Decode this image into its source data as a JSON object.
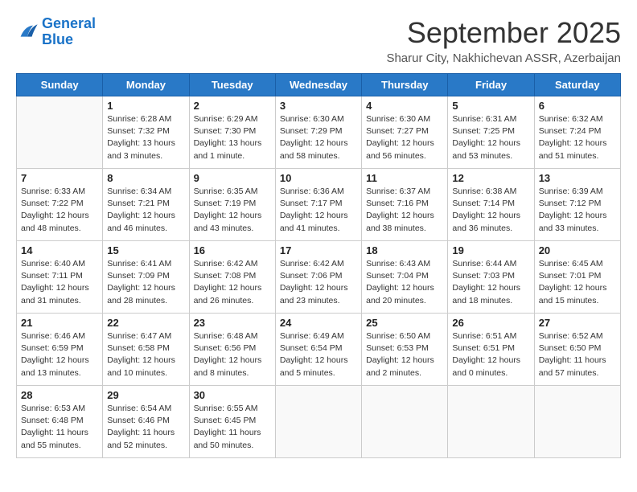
{
  "header": {
    "logo_line1": "General",
    "logo_line2": "Blue",
    "month": "September 2025",
    "location": "Sharur City, Nakhichevan ASSR, Azerbaijan"
  },
  "weekdays": [
    "Sunday",
    "Monday",
    "Tuesday",
    "Wednesday",
    "Thursday",
    "Friday",
    "Saturday"
  ],
  "weeks": [
    [
      {
        "day": "",
        "info": ""
      },
      {
        "day": "1",
        "info": "Sunrise: 6:28 AM\nSunset: 7:32 PM\nDaylight: 13 hours\nand 3 minutes."
      },
      {
        "day": "2",
        "info": "Sunrise: 6:29 AM\nSunset: 7:30 PM\nDaylight: 13 hours\nand 1 minute."
      },
      {
        "day": "3",
        "info": "Sunrise: 6:30 AM\nSunset: 7:29 PM\nDaylight: 12 hours\nand 58 minutes."
      },
      {
        "day": "4",
        "info": "Sunrise: 6:30 AM\nSunset: 7:27 PM\nDaylight: 12 hours\nand 56 minutes."
      },
      {
        "day": "5",
        "info": "Sunrise: 6:31 AM\nSunset: 7:25 PM\nDaylight: 12 hours\nand 53 minutes."
      },
      {
        "day": "6",
        "info": "Sunrise: 6:32 AM\nSunset: 7:24 PM\nDaylight: 12 hours\nand 51 minutes."
      }
    ],
    [
      {
        "day": "7",
        "info": "Sunrise: 6:33 AM\nSunset: 7:22 PM\nDaylight: 12 hours\nand 48 minutes."
      },
      {
        "day": "8",
        "info": "Sunrise: 6:34 AM\nSunset: 7:21 PM\nDaylight: 12 hours\nand 46 minutes."
      },
      {
        "day": "9",
        "info": "Sunrise: 6:35 AM\nSunset: 7:19 PM\nDaylight: 12 hours\nand 43 minutes."
      },
      {
        "day": "10",
        "info": "Sunrise: 6:36 AM\nSunset: 7:17 PM\nDaylight: 12 hours\nand 41 minutes."
      },
      {
        "day": "11",
        "info": "Sunrise: 6:37 AM\nSunset: 7:16 PM\nDaylight: 12 hours\nand 38 minutes."
      },
      {
        "day": "12",
        "info": "Sunrise: 6:38 AM\nSunset: 7:14 PM\nDaylight: 12 hours\nand 36 minutes."
      },
      {
        "day": "13",
        "info": "Sunrise: 6:39 AM\nSunset: 7:12 PM\nDaylight: 12 hours\nand 33 minutes."
      }
    ],
    [
      {
        "day": "14",
        "info": "Sunrise: 6:40 AM\nSunset: 7:11 PM\nDaylight: 12 hours\nand 31 minutes."
      },
      {
        "day": "15",
        "info": "Sunrise: 6:41 AM\nSunset: 7:09 PM\nDaylight: 12 hours\nand 28 minutes."
      },
      {
        "day": "16",
        "info": "Sunrise: 6:42 AM\nSunset: 7:08 PM\nDaylight: 12 hours\nand 26 minutes."
      },
      {
        "day": "17",
        "info": "Sunrise: 6:42 AM\nSunset: 7:06 PM\nDaylight: 12 hours\nand 23 minutes."
      },
      {
        "day": "18",
        "info": "Sunrise: 6:43 AM\nSunset: 7:04 PM\nDaylight: 12 hours\nand 20 minutes."
      },
      {
        "day": "19",
        "info": "Sunrise: 6:44 AM\nSunset: 7:03 PM\nDaylight: 12 hours\nand 18 minutes."
      },
      {
        "day": "20",
        "info": "Sunrise: 6:45 AM\nSunset: 7:01 PM\nDaylight: 12 hours\nand 15 minutes."
      }
    ],
    [
      {
        "day": "21",
        "info": "Sunrise: 6:46 AM\nSunset: 6:59 PM\nDaylight: 12 hours\nand 13 minutes."
      },
      {
        "day": "22",
        "info": "Sunrise: 6:47 AM\nSunset: 6:58 PM\nDaylight: 12 hours\nand 10 minutes."
      },
      {
        "day": "23",
        "info": "Sunrise: 6:48 AM\nSunset: 6:56 PM\nDaylight: 12 hours\nand 8 minutes."
      },
      {
        "day": "24",
        "info": "Sunrise: 6:49 AM\nSunset: 6:54 PM\nDaylight: 12 hours\nand 5 minutes."
      },
      {
        "day": "25",
        "info": "Sunrise: 6:50 AM\nSunset: 6:53 PM\nDaylight: 12 hours\nand 2 minutes."
      },
      {
        "day": "26",
        "info": "Sunrise: 6:51 AM\nSunset: 6:51 PM\nDaylight: 12 hours\nand 0 minutes."
      },
      {
        "day": "27",
        "info": "Sunrise: 6:52 AM\nSunset: 6:50 PM\nDaylight: 11 hours\nand 57 minutes."
      }
    ],
    [
      {
        "day": "28",
        "info": "Sunrise: 6:53 AM\nSunset: 6:48 PM\nDaylight: 11 hours\nand 55 minutes."
      },
      {
        "day": "29",
        "info": "Sunrise: 6:54 AM\nSunset: 6:46 PM\nDaylight: 11 hours\nand 52 minutes."
      },
      {
        "day": "30",
        "info": "Sunrise: 6:55 AM\nSunset: 6:45 PM\nDaylight: 11 hours\nand 50 minutes."
      },
      {
        "day": "",
        "info": ""
      },
      {
        "day": "",
        "info": ""
      },
      {
        "day": "",
        "info": ""
      },
      {
        "day": "",
        "info": ""
      }
    ]
  ]
}
